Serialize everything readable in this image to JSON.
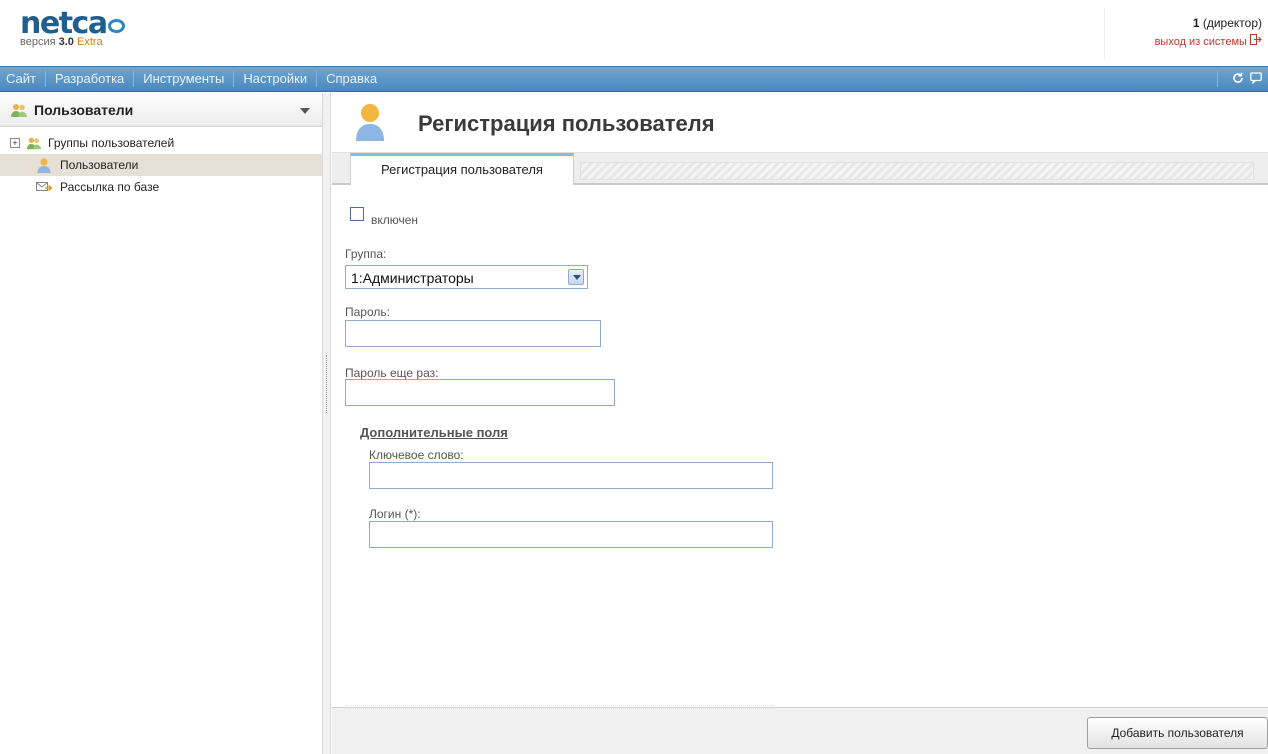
{
  "header": {
    "logo_text": "netcat",
    "version_prefix": "версия",
    "version_number": "3.0",
    "version_edition": "Extra",
    "user_id": "1",
    "user_role": "(директор)",
    "logout_label": "выход из системы"
  },
  "menu": {
    "items": [
      {
        "label": "Сайт"
      },
      {
        "label": "Разработка"
      },
      {
        "label": "Инструменты"
      },
      {
        "label": "Настройки"
      },
      {
        "label": "Справка"
      }
    ]
  },
  "sidebar": {
    "title": "Пользователи",
    "items": [
      {
        "label": "Группы пользователей",
        "icon": "users-group-icon",
        "expandable": true
      },
      {
        "label": "Пользователи",
        "icon": "user-icon",
        "active": true
      },
      {
        "label": "Рассылка по базе",
        "icon": "mail-send-icon"
      }
    ],
    "expander_symbol": "+"
  },
  "main": {
    "title": "Регистрация пользователя",
    "tab_label": "Регистрация пользователя",
    "form": {
      "enabled_label": "включен",
      "group_label": "Группа:",
      "group_value": "1:Администраторы",
      "password_label": "Пароль:",
      "password_value": "",
      "password_repeat_label": "Пароль еще раз:",
      "password_repeat_value": "",
      "extra_fields_label": "Дополнительные поля",
      "keyword_label": "Ключевое слово:",
      "keyword_value": "",
      "login_label": "Логин (*):",
      "login_value": ""
    },
    "submit_label": "Добавить пользователя"
  },
  "colors": {
    "menubar": "#4a88bd",
    "logo": "#1f5f8f",
    "edition": "#e07a1a",
    "logout": "#c0392b",
    "active_row": "#e6e0d6"
  }
}
